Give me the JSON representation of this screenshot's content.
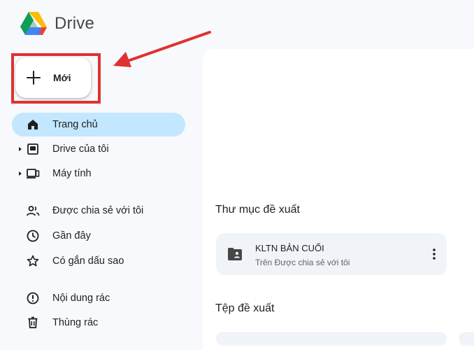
{
  "app": {
    "title": "Drive"
  },
  "new_button": {
    "label": "Mới"
  },
  "nav": {
    "items": [
      {
        "label": "Trang chủ",
        "icon": "home-icon",
        "active": true
      },
      {
        "label": "Drive của tôi",
        "icon": "my-drive-icon",
        "expandable": true
      },
      {
        "label": "Máy tính",
        "icon": "computer-icon",
        "expandable": true
      },
      {
        "label": "Được chia sẻ với tôi",
        "icon": "shared-icon"
      },
      {
        "label": "Gần đây",
        "icon": "clock-icon"
      },
      {
        "label": "Có gắn dấu sao",
        "icon": "star-icon"
      },
      {
        "label": "Nội dung rác",
        "icon": "spam-icon"
      },
      {
        "label": "Thùng rác",
        "icon": "trash-icon"
      }
    ]
  },
  "main": {
    "suggested_folders_title": "Thư mục đề xuất",
    "folder": {
      "name": "KLTN BẢN CUỐI",
      "location": "Trên Được chia sẻ với tôi"
    },
    "suggested_files_title": "Tệp đề xuất"
  },
  "colors": {
    "active_nav": "#c2e7ff",
    "annotation": "#e03131",
    "card": "#f0f4f9"
  }
}
